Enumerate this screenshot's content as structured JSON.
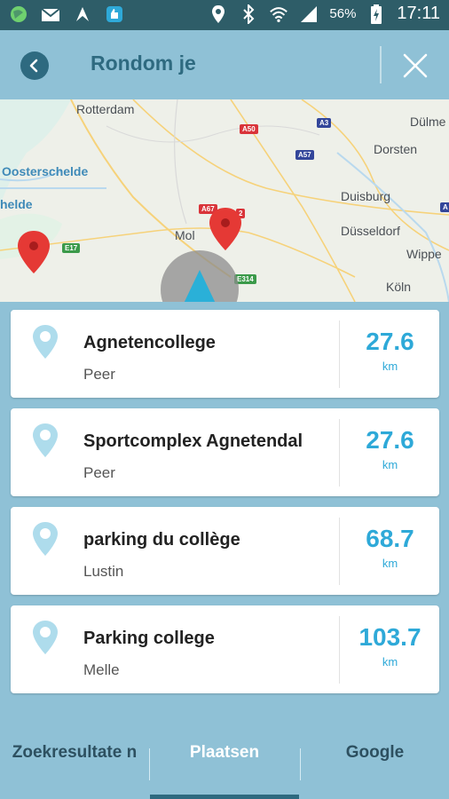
{
  "status_bar": {
    "battery_percent": "56%",
    "time": "17:11",
    "icons": [
      "globe-icon",
      "mail-icon",
      "app-icon",
      "thumbs-up-icon",
      "location-icon",
      "bluetooth-icon",
      "wifi-icon",
      "signal-icon",
      "battery-icon"
    ]
  },
  "header": {
    "title": "Rondom je",
    "back_icon": "chevron-left-icon",
    "close_icon": "close-icon"
  },
  "map": {
    "labels": {
      "rotterdam": "Rotterdam",
      "dulmen": "Dülme",
      "dorsten": "Dorsten",
      "oosterschelde": "Oosterschelde",
      "helde": "helde",
      "duisburg": "Duisburg",
      "mol": "Mol",
      "dusseldorf": "Düsseldorf",
      "wipper": "Wippe",
      "koln": "Köln"
    },
    "road_shields": {
      "a50": "A50",
      "a3": "A3",
      "a57": "A57",
      "a67": "A67",
      "a2": "2",
      "e17": "E17",
      "e314": "E314",
      "a_edge": "A"
    }
  },
  "results": [
    {
      "name": "Agnetencollege",
      "place": "Peer",
      "distance": "27.6",
      "unit": "km"
    },
    {
      "name": "Sportcomplex Agnetendal",
      "place": "Peer",
      "distance": "27.6",
      "unit": "km"
    },
    {
      "name": "parking du collège",
      "place": "Lustin",
      "distance": "68.7",
      "unit": "km"
    },
    {
      "name": "Parking college",
      "place": "Melle",
      "distance": "103.7",
      "unit": "km"
    }
  ],
  "tabs": [
    {
      "label": "Zoekresultate n",
      "active": false
    },
    {
      "label": "Plaatsen",
      "active": true
    },
    {
      "label": "Google",
      "active": false
    }
  ],
  "colors": {
    "accent": "#2ea9d8",
    "header_bg": "#8fc1d6",
    "header_text": "#2e6a80",
    "status_bar": "#2e5d68",
    "marker": "#e53935"
  }
}
